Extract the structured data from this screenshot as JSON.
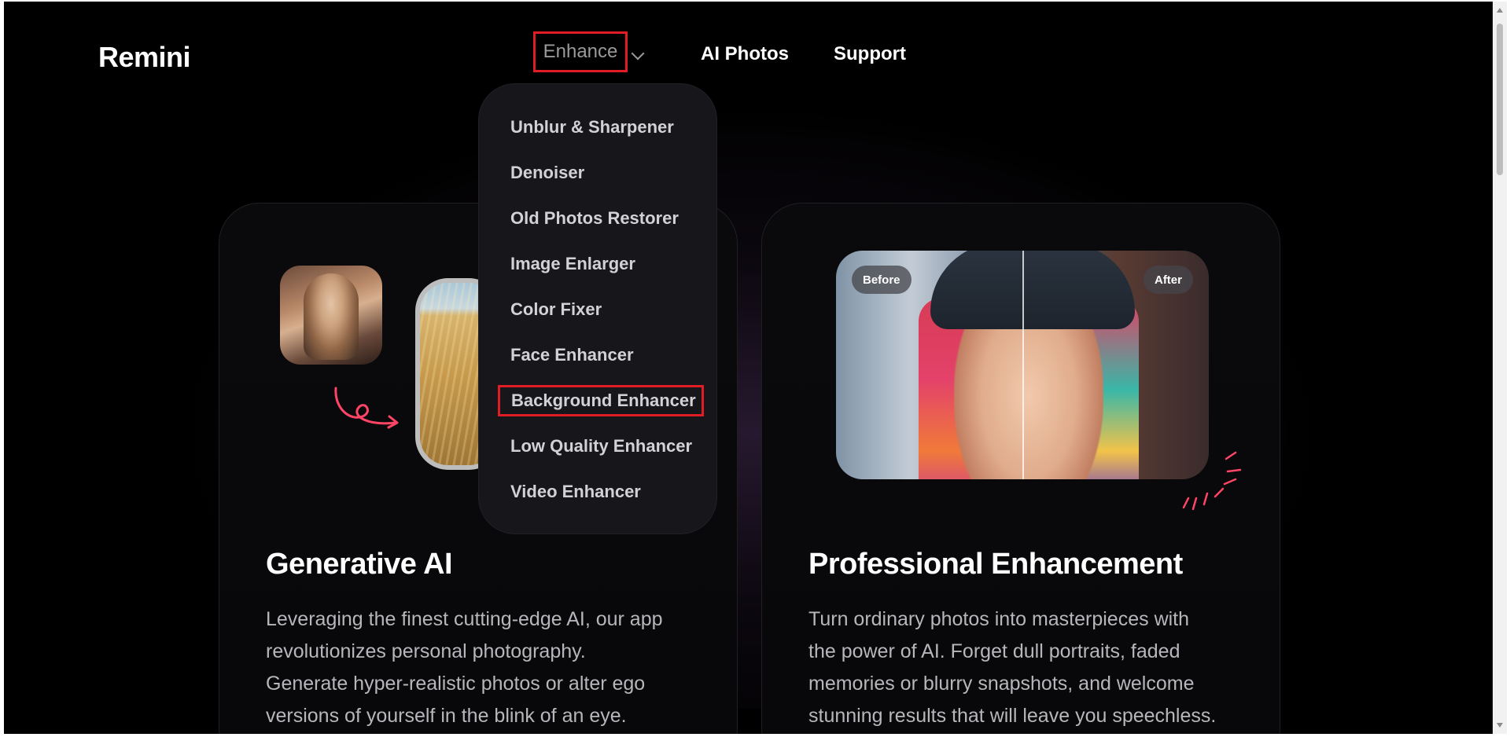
{
  "header": {
    "logo": "Remini",
    "nav": [
      {
        "label": "Enhance"
      },
      {
        "label": "AI Photos"
      },
      {
        "label": "Support"
      }
    ]
  },
  "dropdown": {
    "items": [
      {
        "label": "Unblur & Sharpener"
      },
      {
        "label": "Denoiser"
      },
      {
        "label": "Old Photos Restorer"
      },
      {
        "label": "Image Enlarger"
      },
      {
        "label": "Color Fixer"
      },
      {
        "label": "Face Enhancer"
      },
      {
        "label": "Background Enhancer"
      },
      {
        "label": "Low Quality Enhancer"
      },
      {
        "label": "Video Enhancer"
      }
    ]
  },
  "cards": [
    {
      "title": "Generative AI",
      "text_lines": [
        "Leveraging the finest cutting-edge AI, our app",
        "revolutionizes personal photography.",
        "Generate hyper-realistic photos or alter ego",
        "versions of yourself in the blink of an eye."
      ]
    },
    {
      "title": "Professional Enhancement",
      "before_label": "Before",
      "after_label": "After",
      "text_lines": [
        "Turn ordinary photos into masterpieces with",
        "the power of AI. Forget dull portraits, faded",
        "memories or blurry snapshots, and welcome",
        "stunning results that will leave you speechless."
      ]
    }
  ],
  "colors": {
    "background": "#000000",
    "highlight": "#e01c24",
    "accent_pink": "#ff4566"
  }
}
